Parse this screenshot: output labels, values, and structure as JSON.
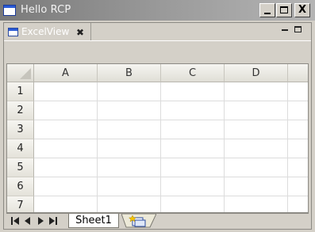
{
  "window": {
    "title": "Hello RCP",
    "minimize_label": "_",
    "maximize_label": "",
    "close_label": "X"
  },
  "view": {
    "tab_label": "ExcelView",
    "tab_close": "✖"
  },
  "grid": {
    "columns": [
      "A",
      "B",
      "C",
      "D"
    ],
    "rows": [
      "1",
      "2",
      "3",
      "4",
      "5",
      "6",
      "7"
    ]
  },
  "sheets": {
    "active_tab": "Sheet1"
  },
  "icons": {
    "app": "window-icon",
    "view": "view-icon",
    "add_sheet": "insert-sheet-icon",
    "nav": [
      "first-sheet-icon",
      "prev-sheet-icon",
      "next-sheet-icon",
      "last-sheet-icon"
    ]
  }
}
